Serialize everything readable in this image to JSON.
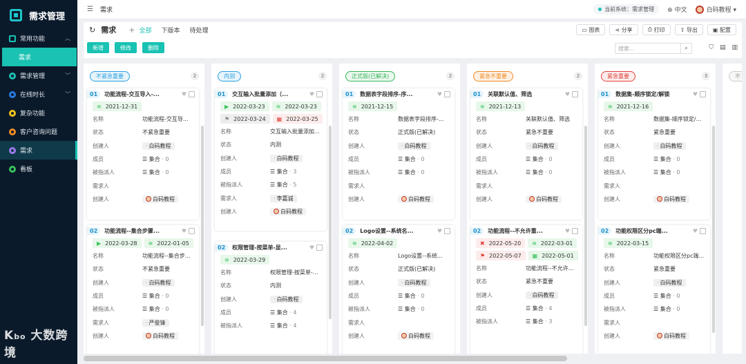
{
  "app": {
    "title": "需求管理"
  },
  "sidebar": {
    "groups": [
      {
        "label": "常用功能",
        "color": "#19c2b3"
      },
      {
        "label": "需求管理",
        "color": "#19c2b3"
      },
      {
        "label": "在线时长",
        "color": "#2a7be4"
      },
      {
        "label": "复杂功能",
        "color": "#f0c419"
      },
      {
        "label": "客户咨询问题",
        "color": "#f08a24"
      },
      {
        "label": "需求",
        "color": "#9b7be8"
      },
      {
        "label": "看板",
        "color": "#37c25a"
      }
    ],
    "sub": {
      "label": "需求"
    }
  },
  "watermark": {
    "text": "大数跨境"
  },
  "topbar": {
    "breadcrumb": "需求",
    "system": "当前系统：需求管理",
    "lang": "中文",
    "user": "白码教程"
  },
  "header": {
    "title": "需求",
    "tabs": [
      "全部",
      "下版本",
      "待处理"
    ],
    "tools": [
      "图表",
      "分享",
      "打印",
      "导出",
      "配置"
    ]
  },
  "actions": {
    "new": "新增",
    "edit": "修改",
    "delete": "删除",
    "search_placeholder": "搜索..."
  },
  "fields": {
    "name": "名称",
    "status": "状态",
    "creator": "创建人",
    "member": "成员",
    "assignee": "被指派人",
    "requester": "需求人",
    "set": "集合",
    "zero": "0"
  },
  "lanes": [
    {
      "label": "不紧急重要",
      "count": "2",
      "color": "#2a9ee0",
      "bg": "#e6f4fb"
    },
    {
      "label": "内测",
      "count": "2",
      "color": "#2a9ee0",
      "bg": "#e6f4fb"
    },
    {
      "label": "正式版(已解决)",
      "count": "2",
      "color": "#37b55a",
      "bg": "#eaf8ee"
    },
    {
      "label": "紧急不重要",
      "count": "2",
      "color": "#f08a24",
      "bg": "#fdf0e3"
    },
    {
      "label": "紧急重要",
      "count": "3",
      "color": "#e0403b",
      "bg": "#fdeceb"
    },
    {
      "label": "不"
    }
  ],
  "cards": {
    "c11": {
      "no": "01",
      "title": "功能流程-交互导入-...",
      "d1": "2021-12-31",
      "name": "功能流程-交互导...",
      "status": "不紧急重要",
      "creator": "白码教程",
      "member": "0",
      "assignee": "0",
      "requester": "",
      "owner": "白码教程"
    },
    "c12": {
      "no": "02",
      "title": "功能流程--集合步骤...",
      "d1": "2022-03-28",
      "d2": "2022-01-05",
      "name": "功能流程--集合步...",
      "status": "不紧急重要",
      "creator": "白码教程",
      "member": "0",
      "assignee": "0",
      "requester": "严俊锋",
      "owner": "白码教程"
    },
    "c21": {
      "no": "01",
      "title": "交互输入批量添加（...",
      "d1": "2022-03-23",
      "d2": "2022-03-23",
      "d3": "2022-03-24",
      "d4": "2022-03-25",
      "name": "交互输入批量添加...",
      "status": "内测",
      "creator": "白码教程",
      "member": "3",
      "assignee": "5",
      "requester": "李嘉诚",
      "owner": "白码教程"
    },
    "c22": {
      "no": "02",
      "title": "权限管理-按菜单-显...",
      "d1": "2022-03-29",
      "name": "权限管理-按菜单-...",
      "status": "内测",
      "creator": "白码教程",
      "member": "4",
      "assignee": "4"
    },
    "c31": {
      "no": "01",
      "title": "数据表字段排序-序...",
      "d1": "2021-12-15",
      "name": "数据表字段排序-...",
      "status": "正式版(已解决)",
      "creator": "白码教程",
      "member": "0",
      "assignee": "0",
      "requester": "",
      "owner": "白码教程"
    },
    "c32": {
      "no": "02",
      "title": "Logo设置--系统名...",
      "d1": "2022-04-02",
      "name": "Logo设置--系统...",
      "status": "正式版(已解决)",
      "creator": "白码教程",
      "member": "0",
      "assignee": "0",
      "requester": "",
      "owner": "白码教程"
    },
    "c41": {
      "no": "01",
      "title": "关联默认值、筛选",
      "d1": "2021-12-13",
      "name": "关联默认值、筛选",
      "status": "紧急不重要",
      "creator": "白码教程",
      "member": "0",
      "assignee": "0",
      "requester": "",
      "owner": "白码教程"
    },
    "c42": {
      "no": "02",
      "title": "功能流程--不允许重...",
      "d1": "2022-05-20",
      "d2": "2022-03-01",
      "d3": "2022-05-07",
      "d4": "2022-05-01",
      "name": "功能流程--不允许...",
      "status": "紧急不重要",
      "creator": "白码教程",
      "member": "4",
      "assignee": "3"
    },
    "c51": {
      "no": "01",
      "title": "数据集-顺序锁定/解锁",
      "d1": "2021-12-16",
      "name": "数据集-顺序锁定/...",
      "status": "紧急重要",
      "creator": "白码教程",
      "member": "0",
      "assignee": "0",
      "requester": "",
      "owner": "白码教程"
    },
    "c52": {
      "no": "02",
      "title": "功能权限区分pc端...",
      "d1": "2022-03-15",
      "name": "功能权限区分pc端...",
      "status": "紧急重要",
      "creator": "白码教程",
      "member": "0",
      "assignee": "0",
      "requester": "",
      "owner": "白码教程"
    }
  }
}
